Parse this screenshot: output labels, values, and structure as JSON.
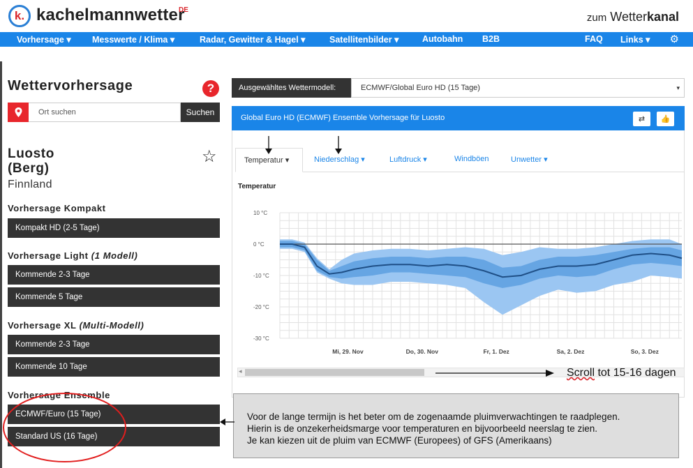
{
  "header": {
    "logo_letter": "k.",
    "brand": "kachelmannwetter",
    "brand_sup": "DE",
    "wetterkanal_prefix": "zum",
    "wetterkanal_mid": "Wetter",
    "wetterkanal_bold": "kanal"
  },
  "nav": {
    "items": [
      "Vorhersage ▾",
      "Messwerte / Klima ▾",
      "Radar, Gewitter & Hagel ▾",
      "Satellitenbilder ▾",
      "Autobahn",
      "B2B"
    ],
    "right_items": [
      "FAQ",
      "Links ▾"
    ],
    "gear": "⚙"
  },
  "left": {
    "title": "Wettervorhersage",
    "help": "?",
    "search_placeholder": "Ort suchen",
    "search_button": "Suchen",
    "location_line1": "Luosto",
    "location_line2": "(Berg)",
    "country": "Finnland",
    "star": "☆",
    "sections": [
      {
        "label": "Vorhersage Kompakt",
        "italic": "",
        "buttons": [
          "Kompakt HD (2-5 Tage)"
        ]
      },
      {
        "label": "Vorhersage Light ",
        "italic": "(1 Modell)",
        "buttons": [
          "Kommende 2-3 Tage",
          "Kommende 5 Tage"
        ]
      },
      {
        "label": "Vorhersage XL ",
        "italic": "(Multi-Modell)",
        "buttons": [
          "Kommende 2-3 Tage",
          "Kommende 10 Tage"
        ]
      },
      {
        "label": "Vorhersage Ensemble",
        "italic": "",
        "buttons": [
          "ECMWF/Euro (15 Tage)",
          "Standard US (16 Tage)"
        ]
      }
    ]
  },
  "model": {
    "label": "Ausgewähltes Wettermodell:",
    "selected": "ECMWF/Global Euro HD (15 Tage)",
    "caret": "▾"
  },
  "forecast": {
    "bar_title": "Global Euro HD (ECMWF) Ensemble Vorhersage für Luosto",
    "icons": [
      "⇄",
      "👍"
    ],
    "tabs": [
      "Temperatur ▾",
      "Niederschlag ▾",
      "Luftdruck ▾",
      "Windböen",
      "Unwetter ▾"
    ],
    "chart_title": "Temperatur"
  },
  "chart_data": {
    "type": "area",
    "title": "Temperatur",
    "y_ticks": [
      "10 °C",
      "0 °C",
      "-10 °C",
      "-20 °C",
      "-30 °C"
    ],
    "y_tick_values": [
      10,
      0,
      -10,
      -20,
      -30
    ],
    "ylim": [
      -30,
      10
    ],
    "x_tick_labels": [
      "Mi, 29. Nov",
      "Do, 30. Nov",
      "Fr, 1. Dez",
      "Sa, 2. Dez",
      "So, 3. Dez"
    ],
    "x_tick_positions": [
      22,
      46,
      70,
      94,
      118
    ],
    "xlim": [
      0,
      130
    ],
    "grid": true,
    "series": [
      {
        "role": "median",
        "x": [
          0,
          4,
          8,
          12,
          16,
          20,
          24,
          30,
          36,
          42,
          48,
          54,
          60,
          66,
          72,
          78,
          84,
          90,
          96,
          102,
          108,
          114,
          120,
          126,
          130
        ],
        "values": [
          0,
          0,
          -1,
          -7,
          -9.5,
          -9,
          -8,
          -7,
          -6.5,
          -6.5,
          -7,
          -6.5,
          -7,
          -8.5,
          -10.5,
          -10,
          -8,
          -7,
          -7,
          -6.5,
          -5,
          -3.5,
          -3,
          -3.5,
          -4.5
        ]
      },
      {
        "role": "inner_band",
        "x": [
          0,
          4,
          8,
          12,
          16,
          20,
          24,
          30,
          36,
          42,
          48,
          54,
          60,
          66,
          72,
          78,
          84,
          90,
          96,
          102,
          108,
          114,
          120,
          126,
          130
        ],
        "upper": [
          1,
          1,
          0,
          -5,
          -8.5,
          -7,
          -5.5,
          -4.5,
          -4,
          -4,
          -4.5,
          -4,
          -4,
          -5,
          -7.5,
          -7,
          -5,
          -4,
          -4,
          -3.5,
          -2.5,
          -1.5,
          -1,
          -1,
          -2
        ],
        "lower": [
          -1,
          -1,
          -2,
          -8.5,
          -10.5,
          -11,
          -10.5,
          -10,
          -9,
          -9,
          -9.5,
          -10,
          -10.5,
          -12.5,
          -14,
          -13,
          -11,
          -10,
          -10.5,
          -10,
          -8,
          -6.5,
          -6,
          -6.5,
          -7
        ]
      },
      {
        "role": "outer_band",
        "x": [
          0,
          4,
          8,
          12,
          16,
          20,
          24,
          30,
          36,
          42,
          48,
          54,
          60,
          66,
          72,
          78,
          84,
          90,
          96,
          102,
          108,
          114,
          120,
          126,
          130
        ],
        "upper": [
          1.5,
          1.5,
          0.5,
          -4.5,
          -8,
          -5,
          -3,
          -2,
          -1.5,
          -1.5,
          -2,
          -1.5,
          -1,
          -1.5,
          -3.5,
          -2.5,
          -1,
          -1.5,
          -1.5,
          -1,
          0,
          1,
          1.5,
          1.5,
          0
        ],
        "lower": [
          -1.5,
          -1.5,
          -2.5,
          -9,
          -11,
          -12.5,
          -13,
          -13,
          -12,
          -12,
          -12.5,
          -13,
          -14,
          -18.5,
          -22.5,
          -19.5,
          -16.5,
          -14.5,
          -15.5,
          -15,
          -13,
          -12,
          -10,
          -10.5,
          -11
        ]
      }
    ]
  },
  "scroll_note_underlined": "Scroll",
  "scroll_note_rest": " tot 15-16 dagen",
  "note": {
    "line1": "Voor de lange termijn is het beter om de zogenaamde pluimverwachtingen te raadplegen.",
    "line2": "Hierin is de onzekerheidsmarge voor temperaturen en bijvoorbeeld neerslag te zien.",
    "line3": "Je kan kiezen uit de pluim van ECMWF (Europees) of GFS (Amerikaans)"
  },
  "colors": {
    "brand_blue": "#1a85e8",
    "accent_red": "#e8262c",
    "dark_button": "#333333",
    "median_line": "#1f4f86",
    "inner_band": "#5d9fe0",
    "outer_band": "#9bc6f2"
  }
}
